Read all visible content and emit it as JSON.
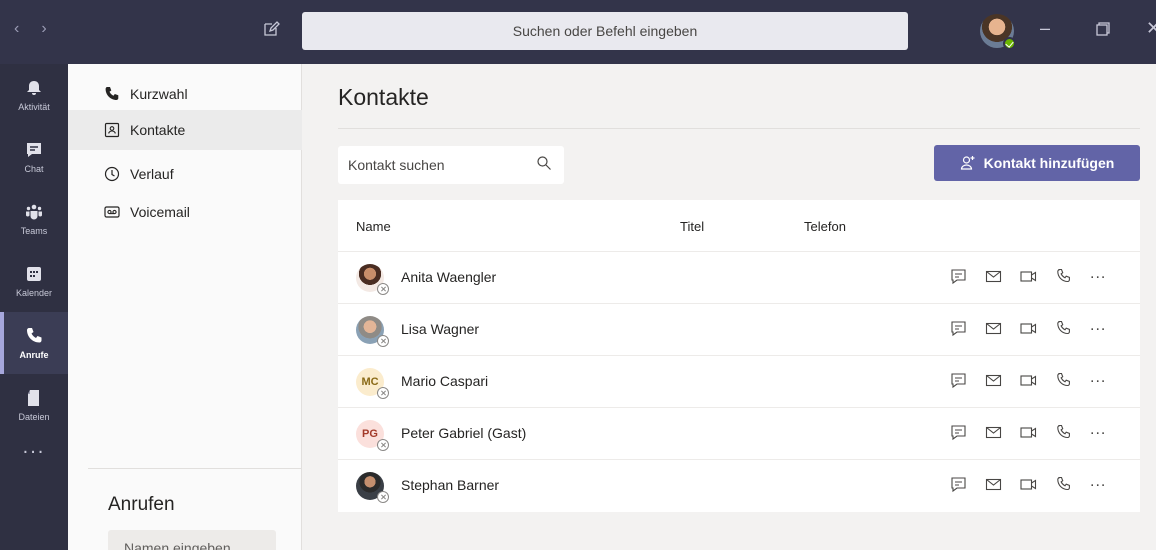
{
  "titlebar": {
    "back_icon": "chevron-left-icon",
    "forward_icon": "chevron-right-icon",
    "compose_icon": "compose-icon",
    "search_placeholder": "Suchen oder Befehl eingeben",
    "presence_color": "#6bb700"
  },
  "rail": {
    "items": [
      {
        "label": "Aktivität",
        "icon": "bell-icon"
      },
      {
        "label": "Chat",
        "icon": "chat-icon"
      },
      {
        "label": "Teams",
        "icon": "teams-icon"
      },
      {
        "label": "Kalender",
        "icon": "calendar-icon"
      },
      {
        "label": "Anrufe",
        "icon": "phone-icon",
        "active": true
      },
      {
        "label": "Dateien",
        "icon": "file-icon"
      }
    ],
    "more": "..."
  },
  "panel": {
    "items": [
      {
        "label": "Kurzwahl",
        "icon": "phone-icon"
      },
      {
        "label": "Kontakte",
        "icon": "contact-card-icon",
        "selected": true
      },
      {
        "label": "Verlauf",
        "icon": "clock-icon"
      },
      {
        "label": "Voicemail",
        "icon": "voicemail-icon"
      }
    ],
    "calls_heading": "Anrufen",
    "calls_placeholder": "Namen eingeben"
  },
  "main": {
    "title": "Kontakte",
    "search_placeholder": "Kontakt suchen",
    "add_button": "Kontakt hinzufügen",
    "accent": "#6264a7",
    "columns": [
      "Name",
      "Titel",
      "Telefon"
    ],
    "contacts": [
      {
        "name": "Anita Waengler",
        "initials": "",
        "avatar": "photo"
      },
      {
        "name": "Lisa Wagner",
        "initials": "",
        "avatar": "photo"
      },
      {
        "name": "Mario Caspari",
        "initials": "MC",
        "avatar": "initials"
      },
      {
        "name": "Peter Gabriel (Gast)",
        "initials": "PG",
        "avatar": "initials"
      },
      {
        "name": "Stephan Barner",
        "initials": "",
        "avatar": "photo"
      }
    ],
    "row_more": "..."
  }
}
